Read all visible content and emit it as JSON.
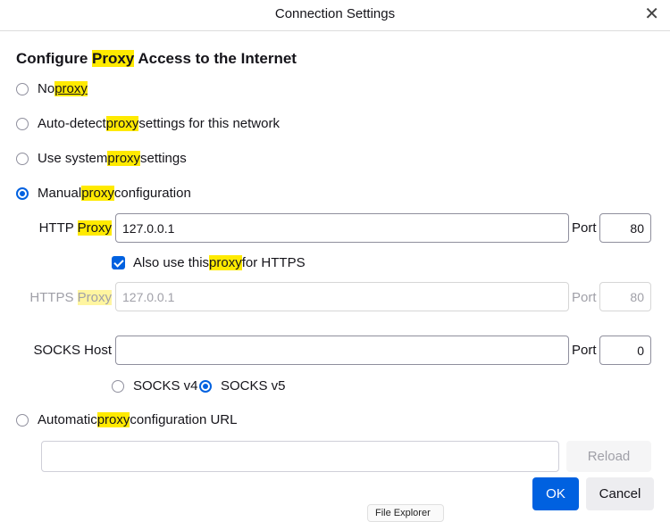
{
  "window": {
    "title": "Connection Settings"
  },
  "heading": {
    "pre": "Configure ",
    "hl": "Proxy",
    "post": " Access to the Internet"
  },
  "options": [
    {
      "pre": "No ",
      "hl": "proxy",
      "post": "",
      "selected": false
    },
    {
      "pre": "Auto-detect ",
      "hl": "proxy",
      "post": " settings for this network",
      "selected": false
    },
    {
      "pre": "Use system ",
      "hl": "proxy",
      "post": " settings",
      "selected": false
    },
    {
      "pre": "Manual ",
      "hl": "proxy",
      "post": " configuration",
      "selected": true
    },
    {
      "pre": "Automatic ",
      "hl": "proxy",
      "post": " configuration URL",
      "selected": false
    }
  ],
  "http": {
    "label_pre": "HTTP ",
    "label_hl": "Proxy",
    "value": "127.0.0.1",
    "port_label": "Port",
    "port": "80"
  },
  "also_https": {
    "pre": "Also use this ",
    "hl": "proxy",
    "post": " for HTTPS",
    "checked": true
  },
  "https": {
    "label_pre": "HTTPS ",
    "label_hl": "Proxy",
    "value": "127.0.0.1",
    "port_label": "Port",
    "port": "80"
  },
  "socks": {
    "label": "SOCKS Host",
    "value": "",
    "port_label": "Port",
    "port": "0",
    "v4": "SOCKS v4",
    "v5": "SOCKS v5",
    "version": "v5"
  },
  "autoconfig": {
    "url": "",
    "reload": "Reload"
  },
  "buttons": {
    "ok": "OK",
    "cancel": "Cancel"
  },
  "tooltip": "File Explorer"
}
